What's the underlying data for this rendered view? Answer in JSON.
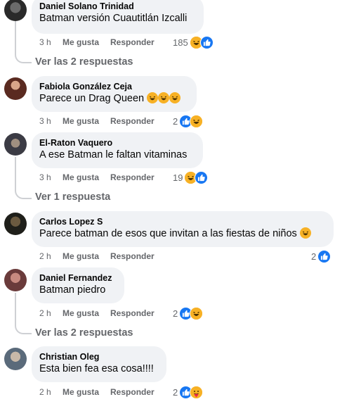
{
  "comments": [
    {
      "author": "Daniel Solano Trinidad",
      "text": "Batman versión Cuautitlán Izcalli",
      "time": "3 h",
      "like_label": "Me gusta",
      "reply_label": "Responder",
      "reaction_count": "185",
      "reactions": [
        "haha",
        "like"
      ],
      "view_replies": "Ver las 2 respuestas"
    },
    {
      "author": "Fabiola González Ceja",
      "text": "Parece un Drag Queen",
      "text_emojis": [
        "haha",
        "haha",
        "haha"
      ],
      "time": "3 h",
      "like_label": "Me gusta",
      "reply_label": "Responder",
      "reaction_count": "2",
      "reactions": [
        "like",
        "haha"
      ]
    },
    {
      "author": "El-Raton Vaquero",
      "text": "A ese Batman le faltan vitaminas",
      "time": "3 h",
      "like_label": "Me gusta",
      "reply_label": "Responder",
      "reaction_count": "19",
      "reactions": [
        "haha",
        "like"
      ],
      "view_replies": "Ver 1 respuesta"
    },
    {
      "author": "Carlos Lopez S",
      "text": "Parece batman de esos que invitan a las fiestas de niños",
      "text_emojis": [
        "haha"
      ],
      "time": "2 h",
      "like_label": "Me gusta",
      "reply_label": "Responder",
      "reaction_count": "2",
      "reactions": [
        "like"
      ]
    },
    {
      "author": "Daniel Fernandez",
      "text": "Batman piedro",
      "time": "2 h",
      "like_label": "Me gusta",
      "reply_label": "Responder",
      "reaction_count": "2",
      "reactions": [
        "like",
        "haha"
      ],
      "view_replies": "Ver las 2 respuestas"
    },
    {
      "author": "Christian Oleg",
      "text": "Esta bien fea esa cosa!!!!",
      "time": "2 h",
      "like_label": "Me gusta",
      "reply_label": "Responder",
      "reaction_count": "2",
      "reactions": [
        "like",
        "care"
      ]
    }
  ],
  "colors": {
    "bubble": "#f0f2f5",
    "meta": "#65676b",
    "like_blue": "#1877f2",
    "haha_yellow": "#f7b125"
  }
}
